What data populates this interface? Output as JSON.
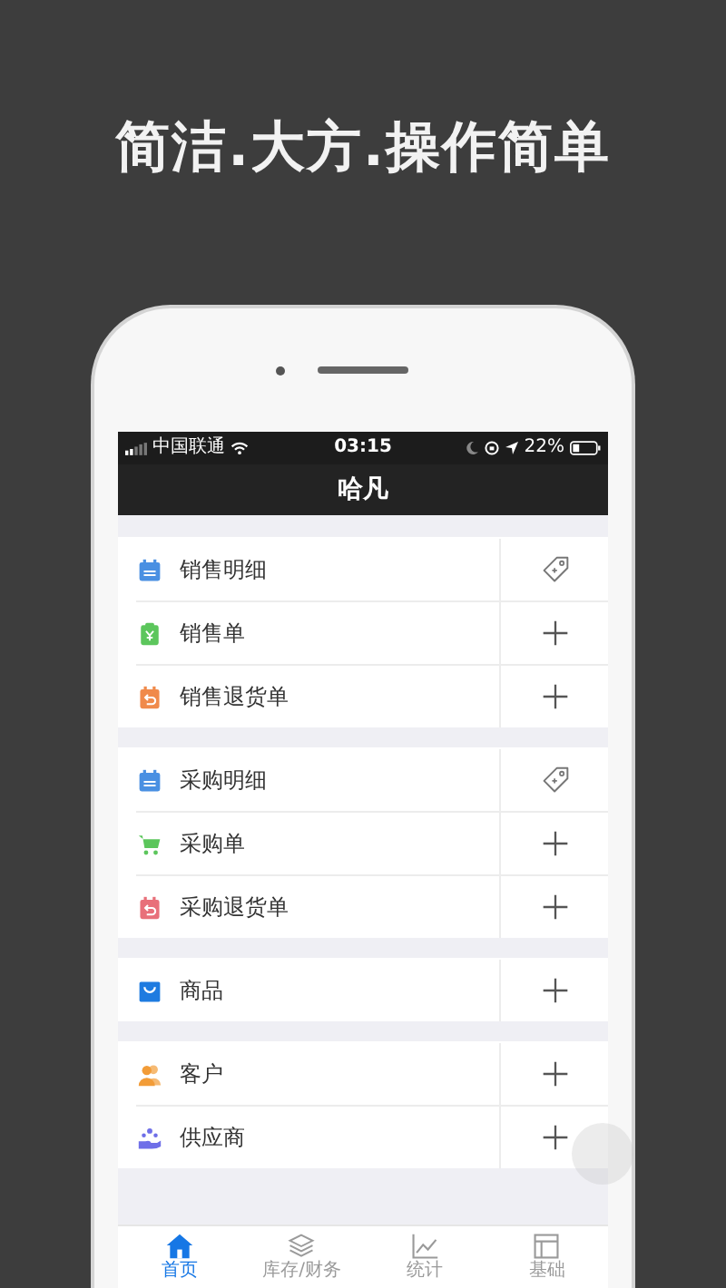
{
  "headline": "简洁.大方.操作简单",
  "status_bar": {
    "carrier": "中国联通",
    "time": "03:15",
    "battery": "22%"
  },
  "nav_title": "哈凡",
  "sections": [
    {
      "rows": [
        {
          "label": "销售明细",
          "kind": "calendar",
          "color": "#4a90e2",
          "action": {
            "kind": "tag"
          }
        },
        {
          "label": "销售单",
          "kind": "clipboard",
          "color": "#5cc65c",
          "action": {
            "kind": "add"
          }
        },
        {
          "label": "销售退货单",
          "kind": "return",
          "color": "#f08a4b",
          "action": {
            "kind": "add"
          }
        }
      ]
    },
    {
      "rows": [
        {
          "label": "采购明细",
          "kind": "calendar",
          "color": "#4a90e2",
          "action": {
            "kind": "tag"
          }
        },
        {
          "label": "采购单",
          "kind": "cart",
          "color": "#5cc65c",
          "action": {
            "kind": "add"
          }
        },
        {
          "label": "采购退货单",
          "kind": "return",
          "color": "#e8707a",
          "action": {
            "kind": "add"
          }
        }
      ]
    },
    {
      "rows": [
        {
          "label": "商品",
          "kind": "bag",
          "color": "#1e7be0",
          "action": {
            "kind": "add"
          }
        }
      ]
    },
    {
      "rows": [
        {
          "label": "客户",
          "kind": "people",
          "color": "#f29c38",
          "action": {
            "kind": "add"
          }
        },
        {
          "label": "供应商",
          "kind": "supplier",
          "color": "#6f6fe8",
          "action": {
            "kind": "add"
          }
        }
      ]
    }
  ],
  "tabs": [
    {
      "label": "首页",
      "selected": true
    },
    {
      "label": "库存/财务",
      "selected": false
    },
    {
      "label": "统计",
      "selected": false
    },
    {
      "label": "基础",
      "selected": false
    }
  ]
}
